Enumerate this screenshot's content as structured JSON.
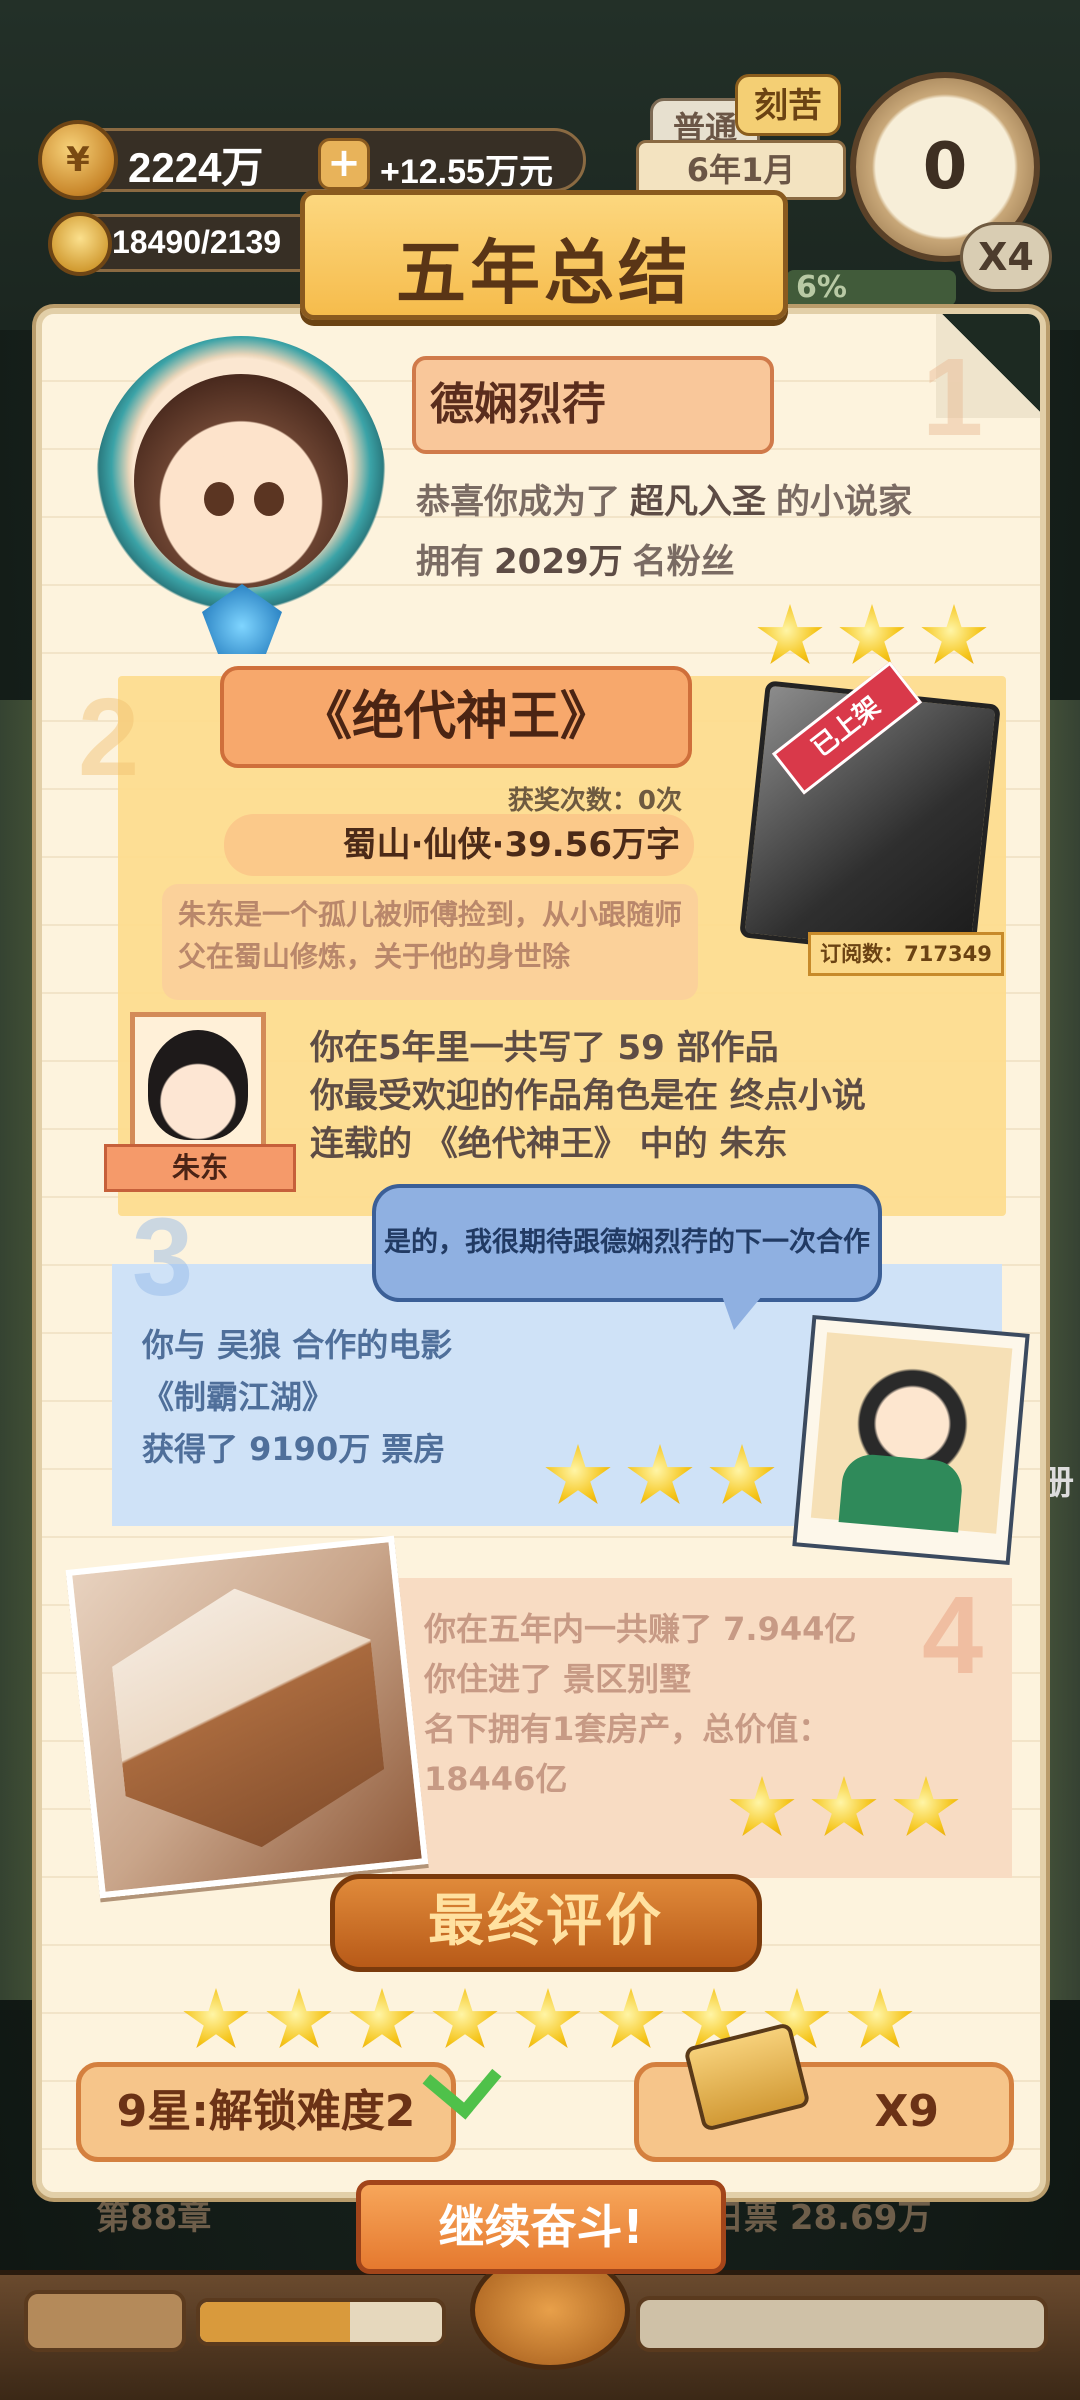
{
  "hud": {
    "coins": "2224万",
    "coin_icon": "coin-icon",
    "income": "+12.55万元",
    "energy": "18490/2139",
    "mode_tabs": [
      "普通",
      "刻苦"
    ],
    "date": "6年1月",
    "clock_value": "0",
    "speed": "X4",
    "progress_pct": "6%"
  },
  "summary": {
    "title": "五年总结",
    "section1": {
      "num": "1",
      "author_name": "德娴烈荇",
      "line1_pre": "恭喜你成为了",
      "line1_hl": "超凡入圣",
      "line1_post": "的小说家",
      "line2_pre": "拥有",
      "line2_hl": "2029万",
      "line2_post": "名粉丝",
      "stars": 3
    },
    "section2": {
      "num": "2",
      "book_title": "《绝代神王》",
      "awards": "获奖次数：0次",
      "genre": "蜀山·仙侠·39.56万字",
      "description": "朱东是一个孤儿被师傅捡到，从小跟随师父在蜀山修炼，关于他的身世除",
      "ribbon": "已上架",
      "subscriptions": "订阅数：717349",
      "character_name": "朱东",
      "stat1": "你在5年里一共写了  59  部作品",
      "stat2": "你最受欢迎的作品角色是在  终点小说",
      "stat3": "连载的  《绝代神王》  中的  朱东"
    },
    "section3": {
      "num": "3",
      "bubble": "是的，我很期待跟德娴烈荇的下一次合作",
      "line1": "你与  吴狼  合作的电影",
      "line2": "《制霸江湖》",
      "line3": "获得了  9190万  票房",
      "stars": 3
    },
    "section4": {
      "num": "4",
      "line1": "你在五年内一共赚了  7.944亿",
      "line2": "你住进了  景区别墅",
      "line3": "名下拥有1套房产，总价值：",
      "line4": "18446亿",
      "stars": 3
    },
    "final": {
      "label": "最终评价",
      "stars": 9,
      "unlock_label": "9星:解锁难度2",
      "reward_label": "X9"
    },
    "continue_label": "继续奋斗!"
  },
  "underlying": {
    "chapter": "第88章",
    "value": "日票  28.69万",
    "side": "册"
  },
  "colors": {
    "star": "#f5c419",
    "card_bg": "#fdf3dd",
    "section2_bg": "#fddc8f",
    "section3_bg": "#cfe2f7",
    "section4_bg": "#f8dcc3"
  }
}
